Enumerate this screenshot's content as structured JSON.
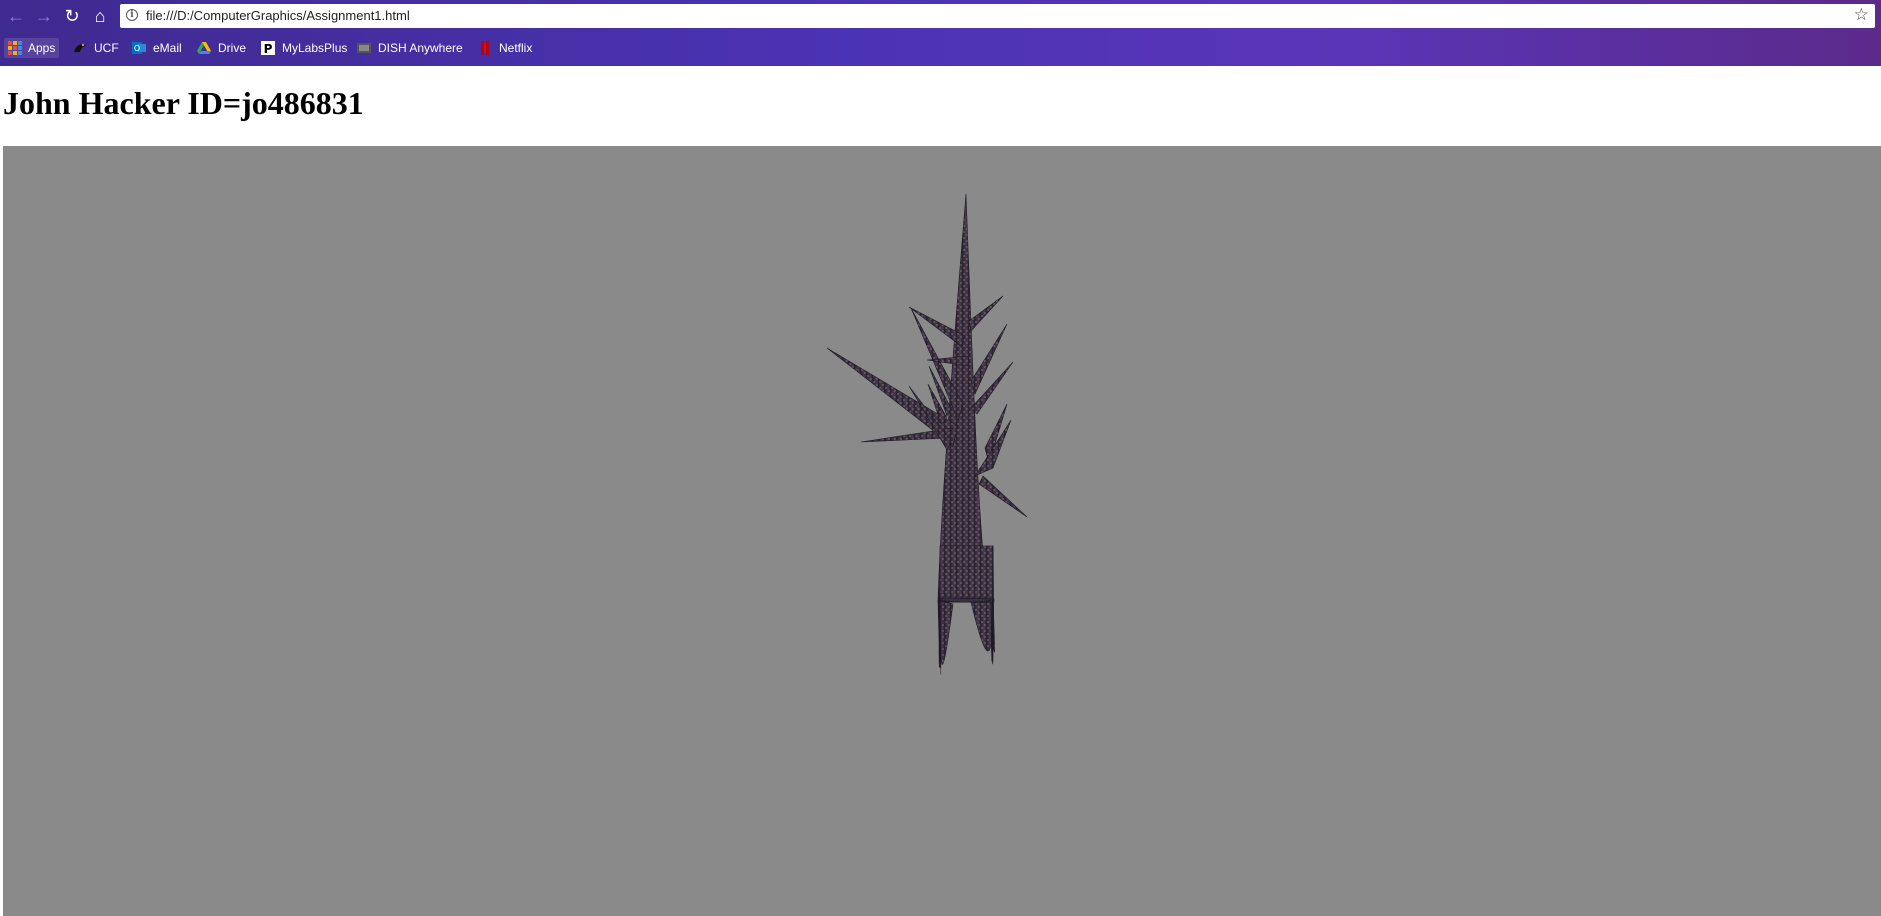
{
  "browser": {
    "url": "file:///D:/ComputerGraphics/Assignment1.html",
    "bookmarks": [
      {
        "label": "Apps",
        "icon": "apps-grid-icon"
      },
      {
        "label": "UCF",
        "icon": "ucf-pegasus-icon"
      },
      {
        "label": "eMail",
        "icon": "outlook-icon"
      },
      {
        "label": "Drive",
        "icon": "google-drive-icon"
      },
      {
        "label": "MyLabsPlus",
        "icon": "mylabsplus-icon"
      },
      {
        "label": "DISH Anywhere",
        "icon": "dish-icon"
      },
      {
        "label": "Netflix",
        "icon": "netflix-icon"
      }
    ],
    "accent_colors": {
      "toolbar": "#4b33b5",
      "canvas_bg": "#8a8a8a"
    }
  },
  "page": {
    "heading": "John Hacker ID=jo486831"
  },
  "scene": {
    "object": "textured-tree-3d"
  }
}
